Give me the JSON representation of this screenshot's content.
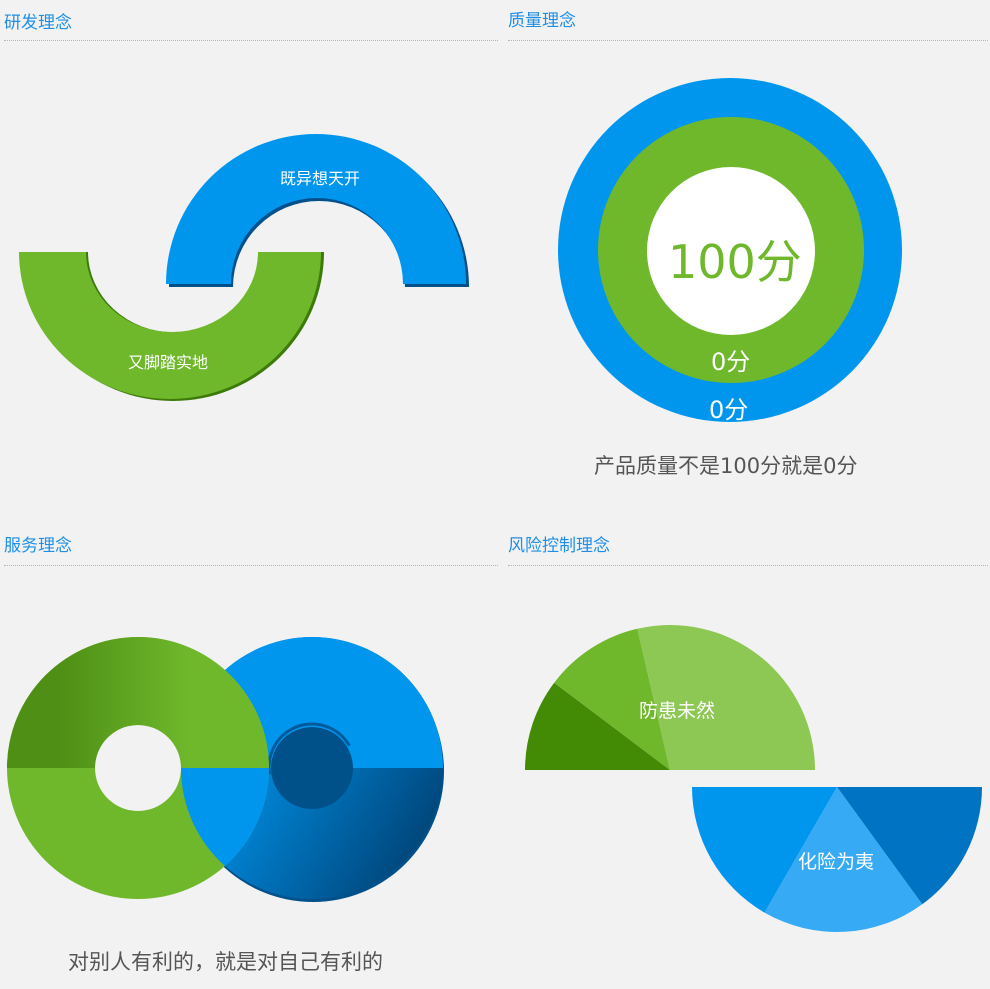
{
  "sections": {
    "rnd": {
      "title": "研发理念",
      "top_label": "既异想天开",
      "bottom_label": "又脚踏实地"
    },
    "quality": {
      "title": "质量理念",
      "center_label": "100分",
      "middle_label": "0分",
      "outer_label": "0分",
      "caption": "产品质量不是100分就是0分"
    },
    "service": {
      "title": "服务理念",
      "caption": "对别人有利的，就是对自己有利的"
    },
    "risk": {
      "title": "风险控制理念",
      "top_label": "防患未然",
      "bottom_label": "化险为夷"
    }
  },
  "colors": {
    "blue": "#0096ee",
    "green": "#6fb82c",
    "dark_green": "#438a05",
    "light_green": "#8dc855",
    "light_blue": "#36aaf4",
    "dark_blue": "#0074c2",
    "header": "#1f8fe6"
  }
}
